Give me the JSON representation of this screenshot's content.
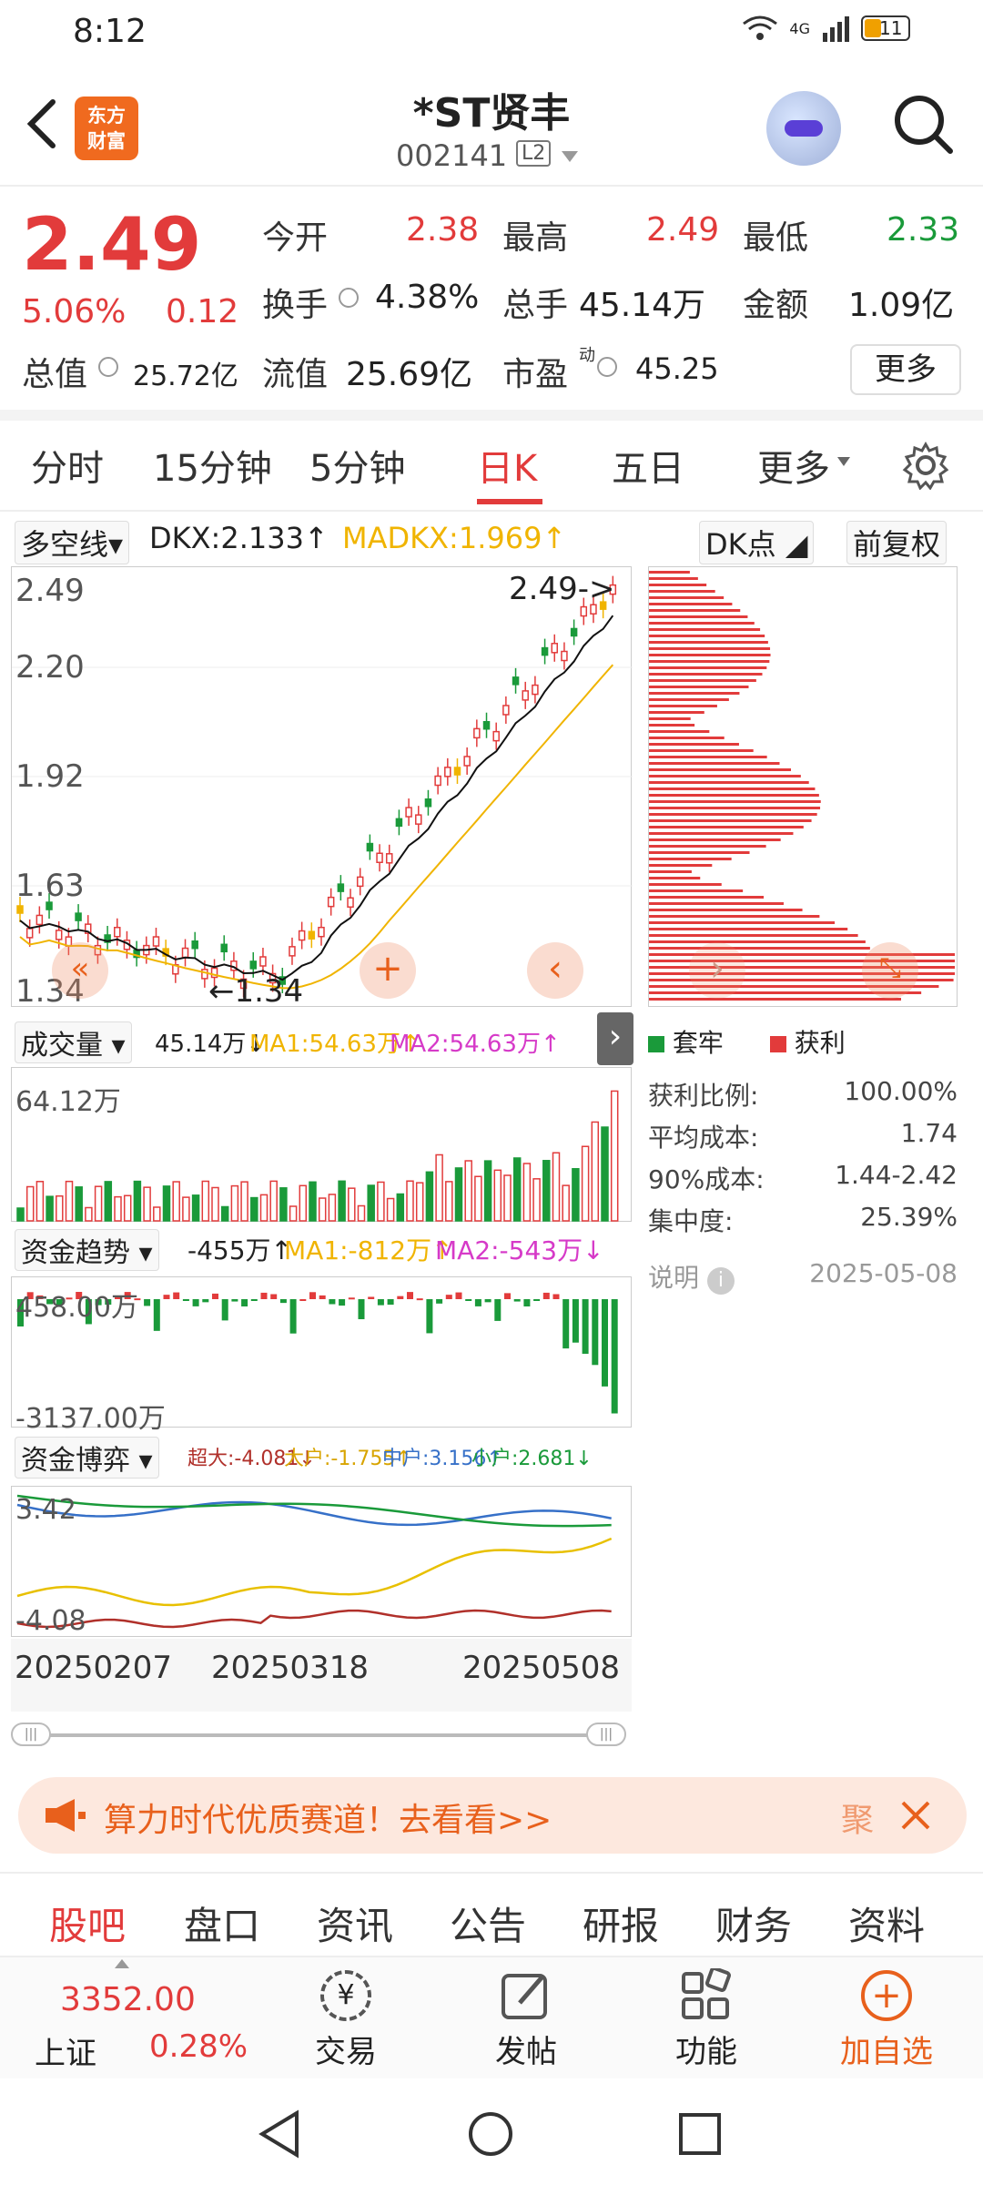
{
  "status": {
    "time": "8:12",
    "signal": "4G",
    "battery": "11"
  },
  "header": {
    "logo_text": "东方财富",
    "stock_name": "*ST贤丰",
    "stock_code": "002141",
    "l2": "L2"
  },
  "quote": {
    "price": "2.49",
    "change_pct": "5.06%",
    "change": "0.12",
    "open_label": "今开",
    "open": "2.38",
    "high_label": "最高",
    "high": "2.49",
    "low_label": "最低",
    "low": "2.33",
    "turnover_label": "换手",
    "turnover": "4.38%",
    "volume_label": "总手",
    "volume": "45.14万",
    "amount_label": "金额",
    "amount": "1.09亿",
    "mktcap_label": "总值",
    "mktcap": "25.72亿",
    "float_label": "流值",
    "float": "25.69亿",
    "pe_label": "市盈",
    "pe_sup": "动",
    "pe": "45.25",
    "more": "更多"
  },
  "tabs": [
    "分时",
    "15分钟",
    "5分钟",
    "日K",
    "五日",
    "更多"
  ],
  "kline": {
    "indicator": "多空线",
    "dkx": "DKX:2.133↑",
    "madkx": "MADKX:1.969↑",
    "dk_button": "DK点",
    "adjust_button": "前复权",
    "y_labels": [
      "2.49",
      "2.20",
      "1.92",
      "1.63",
      "1.34"
    ],
    "max_label": "2.49->",
    "min_label": "←1.34"
  },
  "volume": {
    "title": "成交量",
    "vol": "45.14万↓",
    "ma1": "MA1:54.63万↑",
    "ma2": "MA2:54.63万↑",
    "top": "64.12万"
  },
  "fund_trend": {
    "title": "资金趋势",
    "val": "-455万↑",
    "ma1": "MA1:-812万↑",
    "ma2": "MA2:-543万↓",
    "top": "458.00万",
    "bottom": "-3137.00万"
  },
  "fund_game": {
    "title": "资金博弈",
    "super": "超大:-4.081↓",
    "big": "大户:-1.755↑",
    "mid": "中户:3.156↑",
    "small": "小户:2.681↓",
    "top": "3.42",
    "bottom": "-4.08"
  },
  "dates": [
    "20250207",
    "20250318",
    "20250508"
  ],
  "chip": {
    "legend_trap": "套牢",
    "legend_profit": "获利",
    "rows": [
      {
        "label": "获利比例:",
        "value": "100.00%"
      },
      {
        "label": "平均成本:",
        "value": "1.74"
      },
      {
        "label": "90%成本:",
        "value": "1.44-2.42"
      },
      {
        "label": "集中度:",
        "value": "25.39%"
      }
    ],
    "note": "说明",
    "date": "2025-05-08"
  },
  "banner": {
    "text": "算力时代优质赛道！去看看>>",
    "tag": "聚"
  },
  "bottom_tabs": [
    "股吧",
    "盘口",
    "资讯",
    "公告",
    "研报",
    "财务",
    "资料"
  ],
  "footer": {
    "index_value": "3352.00",
    "index_name": "上证",
    "index_pct": "0.28%",
    "trade": "交易",
    "post": "发帖",
    "func": "功能",
    "add": "加自选"
  },
  "colors": {
    "up": "#e23b3b",
    "down": "#1a9a3a",
    "accent": "#f06a1f"
  }
}
